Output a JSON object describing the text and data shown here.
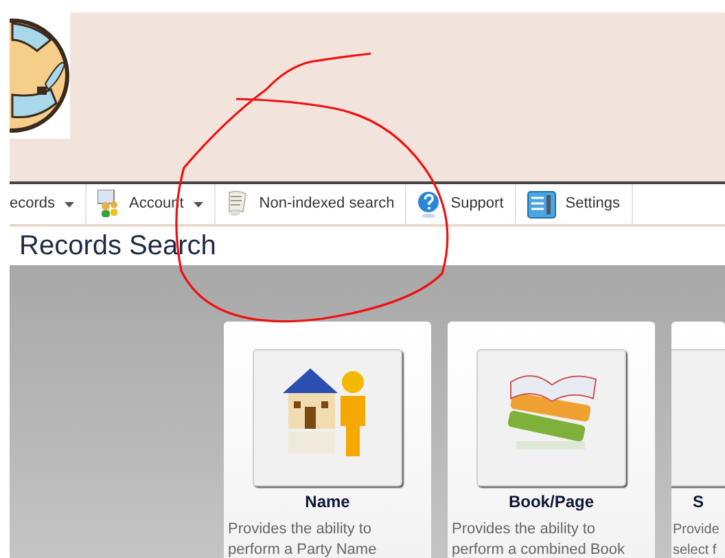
{
  "nav": [
    {
      "label": "ecords",
      "has_menu": true
    },
    {
      "label": "Account",
      "has_menu": true
    },
    {
      "label": "Non-indexed search",
      "has_menu": false
    },
    {
      "label": "Support",
      "has_menu": false
    },
    {
      "label": "Settings",
      "has_menu": false
    }
  ],
  "page_title": "Records Search",
  "cards": [
    {
      "title": "Name",
      "description": [
        "Provides the ability to",
        "perform a Party Name"
      ]
    },
    {
      "title": "Book/Page",
      "description": [
        "Provides the ability to",
        "perform a combined Book"
      ]
    },
    {
      "title": "S",
      "description": [
        "Provide",
        "select f"
      ]
    }
  ]
}
